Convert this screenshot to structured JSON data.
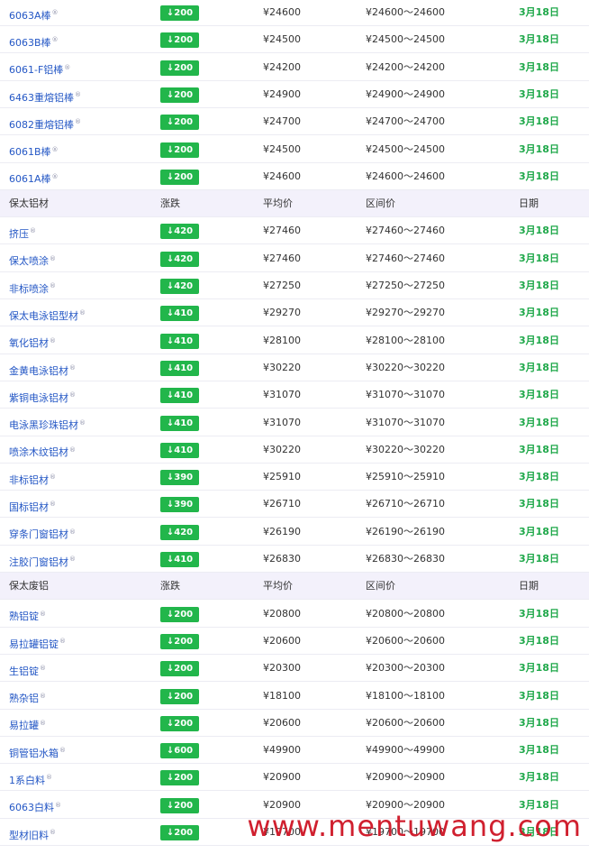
{
  "columns": {
    "change": "涨跌",
    "avg": "平均价",
    "range": "区间价",
    "date": "日期"
  },
  "sections": [
    {
      "title": "",
      "rows": [
        {
          "name": "6063A棒",
          "change": "↓200",
          "avg": "¥24600",
          "range": "¥24600～24600",
          "date": "3月18日"
        },
        {
          "name": "6063B棒",
          "change": "↓200",
          "avg": "¥24500",
          "range": "¥24500～24500",
          "date": "3月18日"
        },
        {
          "name": "6061-F铝棒",
          "change": "↓200",
          "avg": "¥24200",
          "range": "¥24200～24200",
          "date": "3月18日"
        },
        {
          "name": "6463重熔铝棒",
          "change": "↓200",
          "avg": "¥24900",
          "range": "¥24900～24900",
          "date": "3月18日"
        },
        {
          "name": "6082重熔铝棒",
          "change": "↓200",
          "avg": "¥24700",
          "range": "¥24700～24700",
          "date": "3月18日"
        },
        {
          "name": "6061B棒",
          "change": "↓200",
          "avg": "¥24500",
          "range": "¥24500～24500",
          "date": "3月18日"
        },
        {
          "name": "6061A棒",
          "change": "↓200",
          "avg": "¥24600",
          "range": "¥24600～24600",
          "date": "3月18日"
        }
      ]
    },
    {
      "title": "保太铝材",
      "rows": [
        {
          "name": "挤压",
          "change": "↓420",
          "avg": "¥27460",
          "range": "¥27460～27460",
          "date": "3月18日"
        },
        {
          "name": "保太喷涂",
          "change": "↓420",
          "avg": "¥27460",
          "range": "¥27460～27460",
          "date": "3月18日"
        },
        {
          "name": "非标喷涂",
          "change": "↓420",
          "avg": "¥27250",
          "range": "¥27250～27250",
          "date": "3月18日"
        },
        {
          "name": "保太电泳铝型材",
          "change": "↓410",
          "avg": "¥29270",
          "range": "¥29270～29270",
          "date": "3月18日"
        },
        {
          "name": "氧化铝材",
          "change": "↓410",
          "avg": "¥28100",
          "range": "¥28100～28100",
          "date": "3月18日"
        },
        {
          "name": "金黄电泳铝材",
          "change": "↓410",
          "avg": "¥30220",
          "range": "¥30220～30220",
          "date": "3月18日"
        },
        {
          "name": "紫铜电泳铝材",
          "change": "↓410",
          "avg": "¥31070",
          "range": "¥31070～31070",
          "date": "3月18日"
        },
        {
          "name": "电泳黑珍珠铝材",
          "change": "↓410",
          "avg": "¥31070",
          "range": "¥31070～31070",
          "date": "3月18日"
        },
        {
          "name": "喷涂木纹铝材",
          "change": "↓410",
          "avg": "¥30220",
          "range": "¥30220～30220",
          "date": "3月18日"
        },
        {
          "name": "非标铝材",
          "change": "↓390",
          "avg": "¥25910",
          "range": "¥25910～25910",
          "date": "3月18日"
        },
        {
          "name": "国标铝材",
          "change": "↓390",
          "avg": "¥26710",
          "range": "¥26710～26710",
          "date": "3月18日"
        },
        {
          "name": "穿条门窗铝材",
          "change": "↓420",
          "avg": "¥26190",
          "range": "¥26190～26190",
          "date": "3月18日"
        },
        {
          "name": "注胶门窗铝材",
          "change": "↓410",
          "avg": "¥26830",
          "range": "¥26830～26830",
          "date": "3月18日"
        }
      ]
    },
    {
      "title": "保太废铝",
      "rows": [
        {
          "name": "熟铝锭",
          "change": "↓200",
          "avg": "¥20800",
          "range": "¥20800～20800",
          "date": "3月18日"
        },
        {
          "name": "易拉罐铝锭",
          "change": "↓200",
          "avg": "¥20600",
          "range": "¥20600～20600",
          "date": "3月18日"
        },
        {
          "name": "生铝锭",
          "change": "↓200",
          "avg": "¥20300",
          "range": "¥20300～20300",
          "date": "3月18日"
        },
        {
          "name": "熟杂铝",
          "change": "↓200",
          "avg": "¥18100",
          "range": "¥18100～18100",
          "date": "3月18日"
        },
        {
          "name": "易拉罐",
          "change": "↓200",
          "avg": "¥20600",
          "range": "¥20600～20600",
          "date": "3月18日"
        },
        {
          "name": "铜管铝水箱",
          "change": "↓600",
          "avg": "¥49900",
          "range": "¥49900～49900",
          "date": "3月18日"
        },
        {
          "name": "1系白料",
          "change": "↓200",
          "avg": "¥20900",
          "range": "¥20900～20900",
          "date": "3月18日"
        },
        {
          "name": "6063白料",
          "change": "↓200",
          "avg": "¥20900",
          "range": "¥20900～20900",
          "date": "3月18日"
        },
        {
          "name": "型材旧料",
          "change": "↓200",
          "avg": "¥19700",
          "range": "¥19700～19700",
          "date": "3月18日"
        }
      ]
    }
  ],
  "badge_color": "#22b64b",
  "date_color": "#1fa84a",
  "link_color": "#2457c5",
  "watermark": "www.mentuwang.com"
}
